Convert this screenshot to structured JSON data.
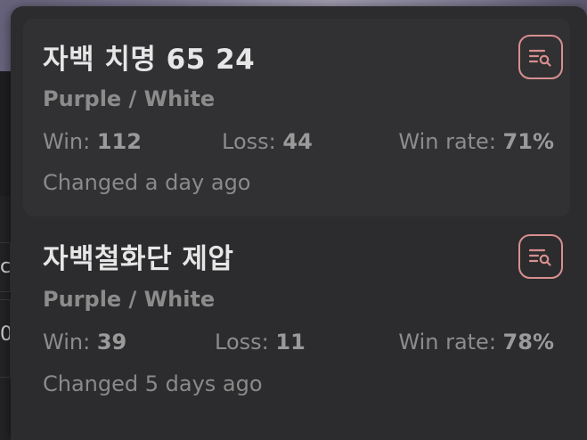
{
  "decks": [
    {
      "name": "자백 치명 65 24",
      "colors": "Purple / White",
      "win_label": "Win:",
      "win_value": "112",
      "loss_label": "Loss:",
      "loss_value": "44",
      "winrate_label": "Win rate:",
      "winrate_value": "71%",
      "changed": "Changed a day ago",
      "action_icon": "list-search-icon"
    },
    {
      "name": "자백철화단 제압",
      "colors": "Purple / White",
      "win_label": "Win:",
      "win_value": "39",
      "loss_label": "Loss:",
      "loss_value": "11",
      "winrate_label": "Win rate:",
      "winrate_value": "78%",
      "changed": "Changed 5 days ago",
      "action_icon": "list-search-icon"
    }
  ],
  "background_fragments": {
    "upper": "c",
    "lower": "0"
  },
  "colors": {
    "panel_bg": "#2c2c2e",
    "card_hover_bg": "#313133",
    "title_text": "#e6e6e6",
    "muted_text": "#8c8c8c",
    "accent_outline": "#d88f8f"
  }
}
